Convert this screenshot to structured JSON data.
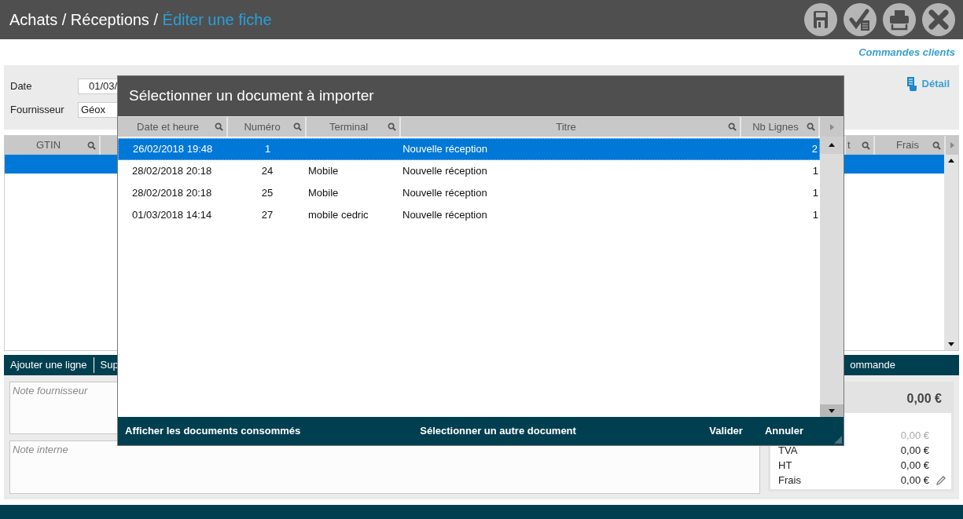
{
  "header": {
    "breadcrumb": "Achats / Réceptions / ",
    "current": "Éditer une fiche",
    "actions": [
      {
        "kind": "save"
      },
      {
        "kind": "validate"
      },
      {
        "kind": "print"
      },
      {
        "kind": "close"
      }
    ]
  },
  "link": "Commandes clients",
  "form": {
    "fields": [
      {
        "label": "Date",
        "value": "01/03/"
      },
      {
        "label": "Fournisseur",
        "value": "Géox"
      }
    ],
    "detail": "Détail"
  },
  "grid": {
    "columns": [
      {
        "label": "GTIN"
      },
      {
        "label": "t"
      },
      {
        "label": "Frais"
      }
    ],
    "rows": [
      {
        "selected": true
      }
    ]
  },
  "toolbar": {
    "left": [
      "Ajouter une ligne",
      "Sup"
    ],
    "right": "ommande"
  },
  "notes": [
    {
      "placeholder": "Note fournisseur"
    },
    {
      "placeholder": "Note interne"
    }
  ],
  "totals": {
    "total": "0,00 €",
    "rows": [
      {
        "value": "0,00 €",
        "disabled": true,
        "editable": false
      },
      {
        "label": "TVA",
        "value": "0,00 €",
        "disabled": false,
        "editable": false
      },
      {
        "label": "HT",
        "value": "0,00 €",
        "disabled": false,
        "editable": false
      },
      {
        "label": "Frais",
        "value": "0,00 €",
        "disabled": false,
        "editable": true
      }
    ]
  },
  "dialog": {
    "title": "Sélectionner un document à importer",
    "columns": [
      {
        "label": "Date et heure"
      },
      {
        "label": "Numéro"
      },
      {
        "label": "Terminal"
      },
      {
        "label": "Titre"
      },
      {
        "label": "Nb Lignes"
      }
    ],
    "rows": [
      {
        "cells": [
          "26/02/2018 19:48",
          "1",
          "",
          "Nouvelle réception",
          "2"
        ],
        "selected": true
      },
      {
        "cells": [
          "28/02/2018 20:18",
          "24",
          "Mobile",
          "Nouvelle réception",
          "1"
        ],
        "selected": false
      },
      {
        "cells": [
          "28/02/2018 20:18",
          "25",
          "Mobile",
          "Nouvelle réception",
          "1"
        ],
        "selected": false
      },
      {
        "cells": [
          "01/03/2018 14:14",
          "27",
          "mobile cedric",
          "Nouvelle réception",
          "1"
        ],
        "selected": false
      }
    ],
    "footer": [
      "Afficher les documents consommés",
      "Sélectionner un autre document",
      "Valider",
      "Annuler"
    ]
  }
}
